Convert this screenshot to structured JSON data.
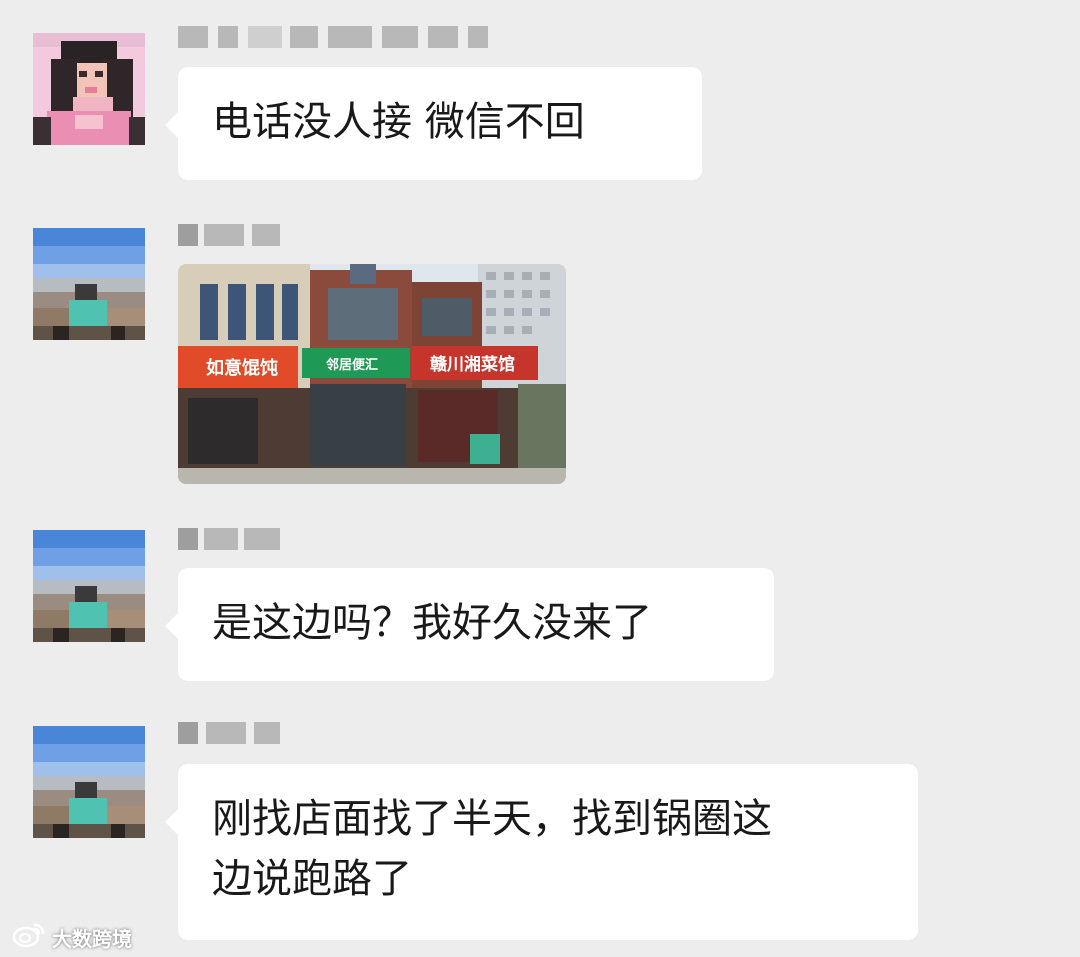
{
  "messages": [
    {
      "type": "text",
      "avatar": "female-avatar",
      "text": "电话没人接 微信不回"
    },
    {
      "type": "image",
      "avatar": "landscape-avatar",
      "image": "storefront-photo",
      "signs": {
        "left": "如意馄饨",
        "middle": "邻居便汇",
        "right": "赣川湘菜馆"
      }
    },
    {
      "type": "text",
      "avatar": "landscape-avatar",
      "text": "是这边吗？我好久没来了"
    },
    {
      "type": "text",
      "avatar": "landscape-avatar",
      "text": "刚找店面找了半天，找到锅圈这\n边说跑路了"
    }
  ],
  "watermark": {
    "text": "大数跨境",
    "icon": "weibo-logo-icon"
  },
  "colors": {
    "background": "#ededed",
    "bubble": "#ffffff",
    "text": "#191919",
    "blurred_name": "#b8b8b8"
  }
}
